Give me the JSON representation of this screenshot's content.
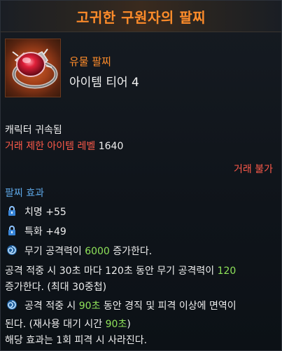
{
  "title": "고귀한 구원자의 팔찌",
  "item": {
    "grade": "유물 팔찌",
    "tier": "아이템 티어 4",
    "icon": "bracelet-icon"
  },
  "bound": "캐릭터 귀속됨",
  "trade_level_label": "거래 제한 아이템 레벨",
  "trade_level_value": "1640",
  "trade_status": "거래 불가",
  "effects_heading": "팔찌 효과",
  "stats": [
    {
      "icon": "lock-icon",
      "text": "치명 +55"
    },
    {
      "icon": "lock-icon",
      "text": "특화 +49"
    }
  ],
  "effect1": {
    "icon": "swirl-icon",
    "pre": "무기 공격력이 ",
    "value": "6000",
    "post": " 증가한다."
  },
  "effect2": {
    "line1_pre": "공격 적중 시 30초 마다 120초 동안 무기 공격력이 ",
    "line1_value": "120",
    "line2": "증가한다. (최대 30중첩)"
  },
  "effect3": {
    "icon": "swirl-icon",
    "pre": "공격 적중 시 ",
    "value": "90초",
    "post": " 동안 경직 및 피격 이상에 면역이",
    "line2_pre": "된다. (재사용 대기 시간 ",
    "line2_value": "90초",
    "line2_post": ")",
    "line3": "해당 효과는 1회 피격 시 사라진다."
  },
  "colors": {
    "accent": "#ff8c2a",
    "red": "#ff5a4a",
    "blue": "#5ea8e8",
    "green": "#8fe35a"
  }
}
